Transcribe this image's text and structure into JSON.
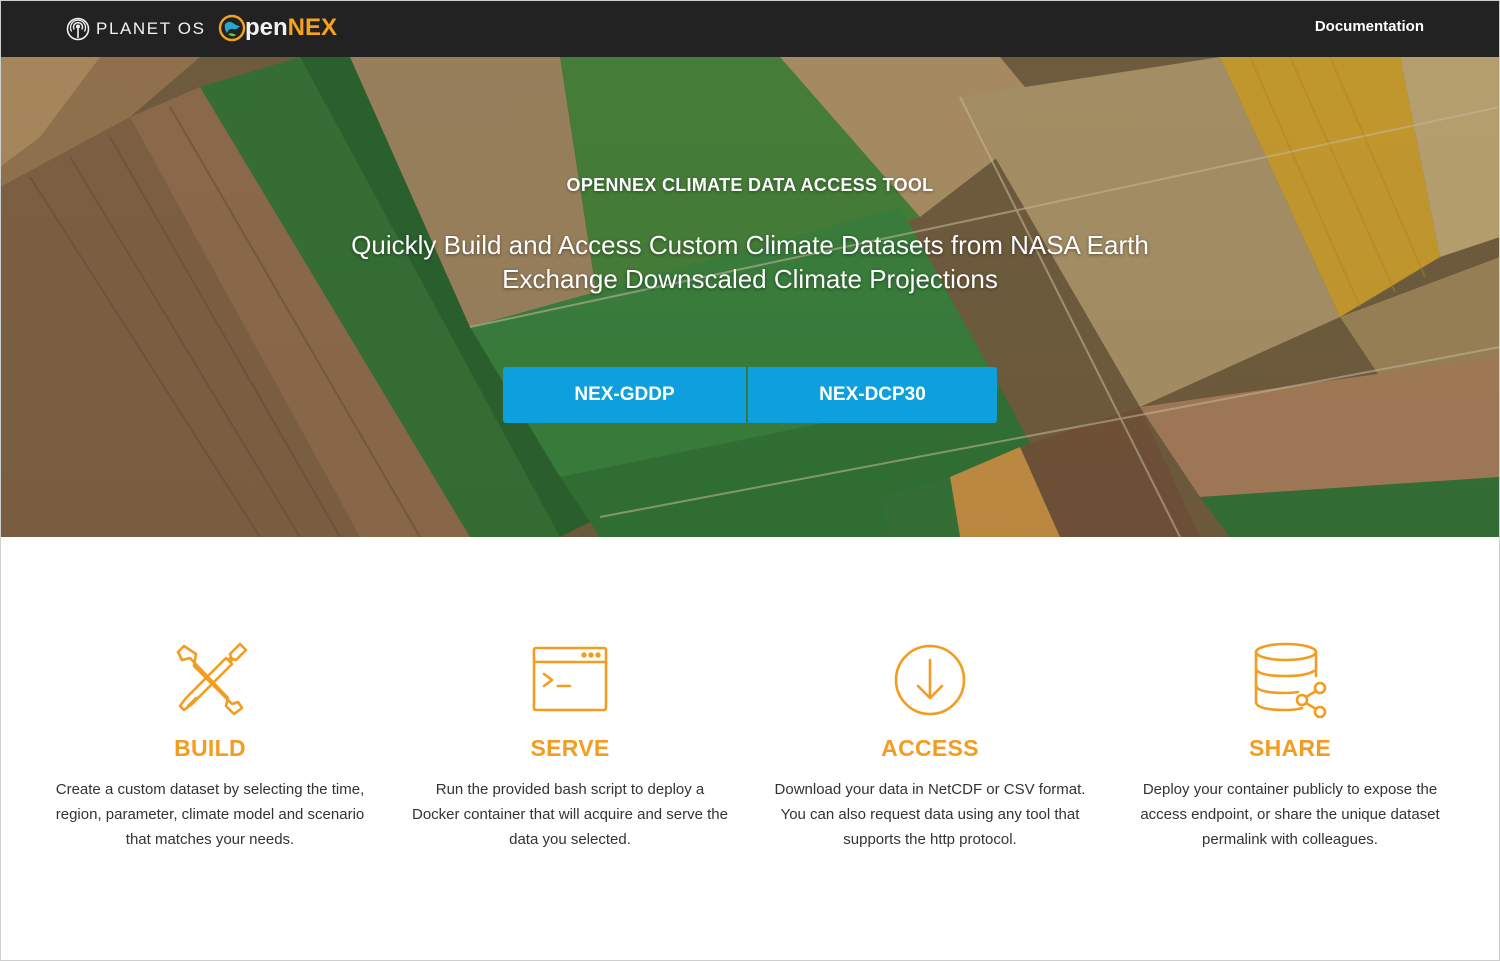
{
  "colors": {
    "topbar_bg": "#222222",
    "accent_orange": "#f39c1f",
    "button_blue": "#0ea0dc",
    "text_dark": "#333333"
  },
  "nav": {
    "planetos_label": "PLANET OS",
    "opennex_prefix": "pen",
    "opennex_suffix": "NEX",
    "documentation_label": "Documentation"
  },
  "hero": {
    "eyebrow": "OPENNEX CLIMATE DATA ACCESS TOOL",
    "title": "Quickly Build and Access Custom Climate Datasets from NASA Earth Exchange Downscaled Climate Projections",
    "buttons": [
      {
        "label": "NEX-GDDP"
      },
      {
        "label": "NEX-DCP30"
      }
    ]
  },
  "features": [
    {
      "icon": "tools-icon",
      "title": "BUILD",
      "text": "Create a custom dataset by selecting the time, region, parameter, climate model and scenario that matches your needs."
    },
    {
      "icon": "terminal-window-icon",
      "title": "SERVE",
      "text": "Run the provided bash script to deploy a Docker container that will acquire and serve the data you selected."
    },
    {
      "icon": "download-circle-icon",
      "title": "ACCESS",
      "text": "Download your data in NetCDF or CSV format. You can also request data using any tool that supports the http protocol."
    },
    {
      "icon": "database-share-icon",
      "title": "SHARE",
      "text": "Deploy your container publicly to expose the access endpoint, or share the unique dataset permalink with colleagues."
    }
  ]
}
